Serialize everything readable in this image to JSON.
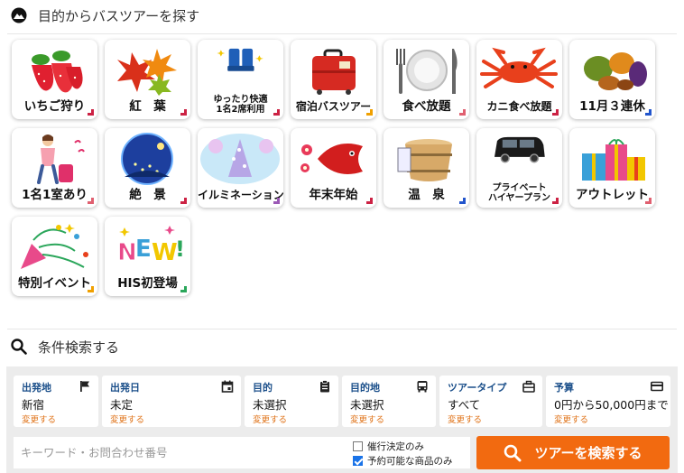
{
  "purpose": {
    "title": "目的からバスツアーを探す",
    "tiles": [
      {
        "label": "いちご狩り",
        "icon": "strawberry-icon",
        "accent": "#cc2244"
      },
      {
        "label": "紅　葉",
        "icon": "autumn-leaves-icon",
        "accent": "#cc2244"
      },
      {
        "label": "ゆったり快適\n1名2席利用",
        "icon": "bus-seats-icon",
        "accent": "#cc2244"
      },
      {
        "label": "宿泊バスツアー",
        "icon": "suitcase-icon",
        "accent": "#f0a000"
      },
      {
        "label": "食べ放題",
        "icon": "cutlery-icon",
        "accent": "#e06070"
      },
      {
        "label": "カニ食べ放題",
        "icon": "crab-icon",
        "accent": "#cc2244"
      },
      {
        "label": "11月３連休",
        "icon": "autumn-harvest-icon",
        "accent": "#2255cc"
      },
      {
        "label": "1名1室あり",
        "icon": "traveler-icon",
        "accent": "#e06070"
      },
      {
        "label": "絶　景",
        "icon": "scenery-icon",
        "accent": "#cc2244"
      },
      {
        "label": "イルミネーション",
        "icon": "illumination-icon",
        "accent": "#9b59b6"
      },
      {
        "label": "年末年始",
        "icon": "new-year-icon",
        "accent": "#cc2244"
      },
      {
        "label": "温　泉",
        "icon": "onsen-bucket-icon",
        "accent": "#2255cc"
      },
      {
        "label": "プライベート\nハイヤープラン",
        "icon": "minivan-icon",
        "accent": "#cc2244"
      },
      {
        "label": "アウトレット",
        "icon": "gift-boxes-icon",
        "accent": "#e06070"
      },
      {
        "label": "特別イベント",
        "icon": "party-popper-icon",
        "accent": "#f0a000"
      },
      {
        "label": "HIS初登場",
        "icon": "new-badge-icon",
        "accent": "#2aa65a"
      }
    ]
  },
  "search": {
    "title": "条件検索する",
    "cards": [
      {
        "title": "出発地",
        "value": "新宿",
        "link": "変更する",
        "icon": "flag-icon"
      },
      {
        "title": "出発日",
        "value": "未定",
        "link": "変更する",
        "icon": "calendar-icon"
      },
      {
        "title": "目的",
        "value": "未選択",
        "link": "変更する",
        "icon": "clipboard-icon"
      },
      {
        "title": "目的地",
        "value": "未選択",
        "link": "変更する",
        "icon": "bus-icon"
      },
      {
        "title": "ツアータイプ",
        "value": "すべて",
        "link": "変更する",
        "icon": "briefcase-icon"
      },
      {
        "title": "予算",
        "value": "0円から50,000円まで",
        "link": "変更する",
        "icon": "credit-card-icon"
      }
    ],
    "keyword_placeholder": "キーワード・お問合わせ番号",
    "checkboxes": [
      {
        "label": "催行決定のみ",
        "checked": false
      },
      {
        "label": "予約可能な商品のみ",
        "checked": true
      }
    ],
    "submit_label": "ツアーを検索する",
    "brand_color": "#f26a10"
  }
}
